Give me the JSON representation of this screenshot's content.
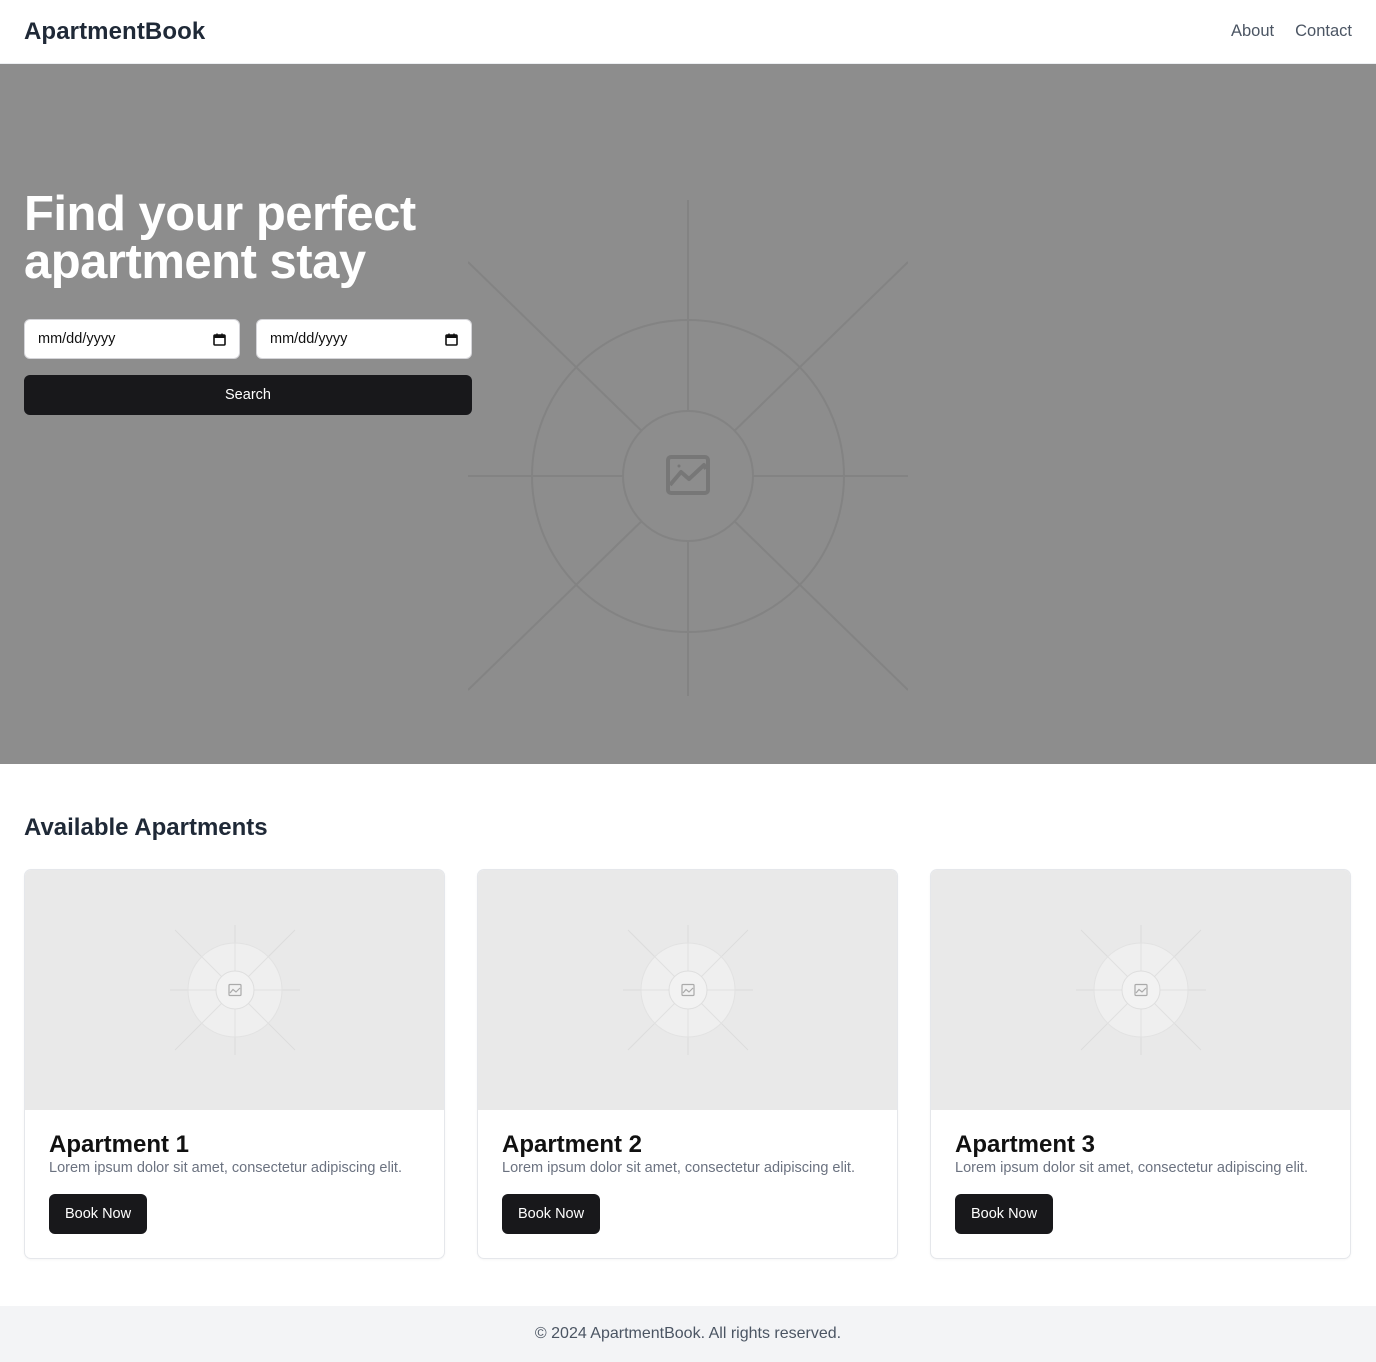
{
  "header": {
    "brand": "ApartmentBook",
    "nav": [
      {
        "label": "About"
      },
      {
        "label": "Contact"
      }
    ]
  },
  "hero": {
    "title": "Find your perfect apartment stay",
    "checkin": {
      "placeholder": "mm/dd/yyyy"
    },
    "checkout": {
      "placeholder": "mm/dd/yyyy"
    },
    "search_label": "Search",
    "background_color": "#8d8d8d"
  },
  "listings": {
    "title": "Available Apartments",
    "apartments": [
      {
        "name": "Apartment 1",
        "description": "Lorem ipsum dolor sit amet, consectetur adipiscing elit.",
        "button_label": "Book Now"
      },
      {
        "name": "Apartment 2",
        "description": "Lorem ipsum dolor sit amet, consectetur adipiscing elit.",
        "button_label": "Book Now"
      },
      {
        "name": "Apartment 3",
        "description": "Lorem ipsum dolor sit amet, consectetur adipiscing elit.",
        "button_label": "Book Now"
      }
    ]
  },
  "footer": {
    "text": "© 2024 ApartmentBook. All rights reserved."
  },
  "colors": {
    "button": "#18181b",
    "placeholder_image": "#e9e9e9",
    "footer_bg": "#f3f4f6"
  },
  "icons": {
    "image_placeholder": "image-icon",
    "calendar": "calendar-icon"
  }
}
